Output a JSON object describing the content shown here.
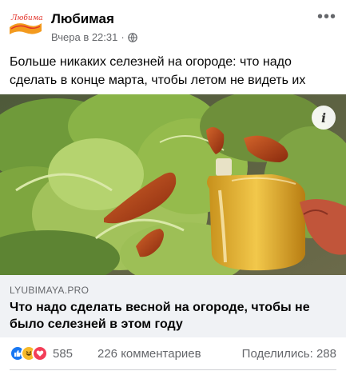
{
  "post": {
    "page_name": "Любимая",
    "timestamp": "Вчера в 22:31",
    "separator": "·",
    "privacy_icon": "globe-icon",
    "more_icon": "more-horizontal-icon",
    "more_label": "•••",
    "text": "Больше никаких селезней на огороде: что надо сделать в конце марта, чтобы летом не видеть их"
  },
  "logo": {
    "text": "Любимая",
    "colors": {
      "orange": "#f39a1e",
      "red": "#e2332a"
    }
  },
  "image": {
    "description_icon": "info-icon",
    "info_label": "i"
  },
  "link_preview": {
    "domain": "LYUBIMAYA.PRO",
    "title": "Что надо сделать весной на огороде, чтобы не было селезней в этом году"
  },
  "stats": {
    "reactions": [
      "like",
      "haha",
      "love"
    ],
    "reaction_count": "585",
    "comments": "226 комментариев",
    "shares": "Поделились: 288"
  },
  "colors": {
    "text": "#050505",
    "secondary": "#65676b",
    "link_bg": "#f0f2f5",
    "like_blue": "#1877f2",
    "love_red": "#f33e58",
    "haha_yellow": "#f7b928"
  }
}
